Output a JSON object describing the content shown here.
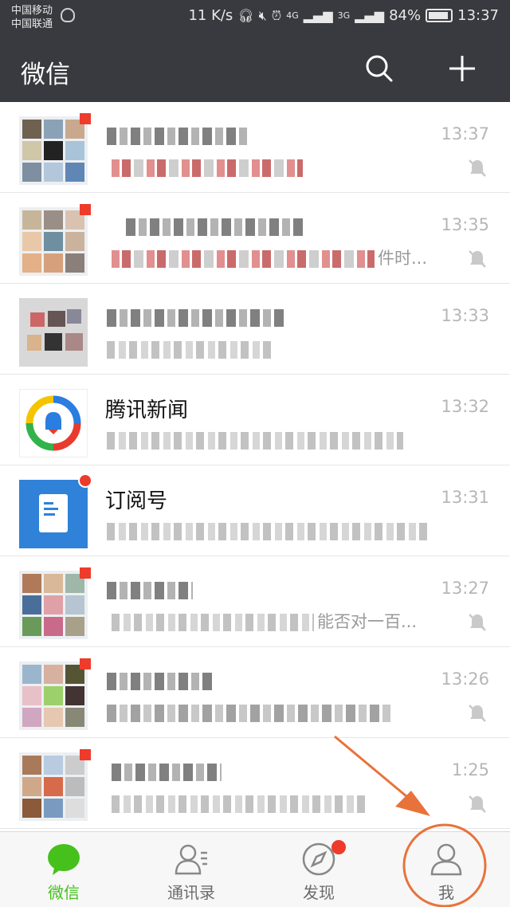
{
  "status_bar": {
    "carrier_1": "中国移动",
    "carrier_2": "中国联通",
    "speed": "11 K/s",
    "signal_1": "4G",
    "signal_2": "3G",
    "battery": "84%",
    "clock": "13:37"
  },
  "header": {
    "title": "微信",
    "search_icon": "search-icon",
    "add_icon": "plus-icon"
  },
  "chats": [
    {
      "name": "",
      "preview": "",
      "time": "13:37",
      "muted": true,
      "unread": "square"
    },
    {
      "name": "",
      "preview": "件时...",
      "time": "13:35",
      "muted": true,
      "unread": "square"
    },
    {
      "name": "",
      "preview": "",
      "time": "13:33",
      "muted": false,
      "unread": "none"
    },
    {
      "name": "腾讯新闻",
      "preview": "",
      "time": "13:32",
      "muted": false,
      "unread": "none"
    },
    {
      "name": "订阅号",
      "preview": "",
      "time": "13:31",
      "muted": false,
      "unread": "dot"
    },
    {
      "name": "",
      "preview": "能否对一百...",
      "time": "13:27",
      "muted": true,
      "unread": "square"
    },
    {
      "name": "",
      "preview": "",
      "time": "13:26",
      "muted": true,
      "unread": "square"
    },
    {
      "name": "",
      "preview": "",
      "time": "1:25",
      "muted": true,
      "unread": "square"
    }
  ],
  "tabs": [
    {
      "label": "微信",
      "icon": "chat-bubble-icon",
      "active": true
    },
    {
      "label": "通讯录",
      "icon": "contacts-icon",
      "active": false
    },
    {
      "label": "发现",
      "icon": "compass-icon",
      "active": false
    },
    {
      "label": "我",
      "icon": "person-icon",
      "active": false
    }
  ],
  "colors": {
    "header_bg": "#393a3f",
    "accent_green": "#46c01b",
    "badge_red": "#ee3b2b",
    "annotation_orange": "#e8733a"
  }
}
